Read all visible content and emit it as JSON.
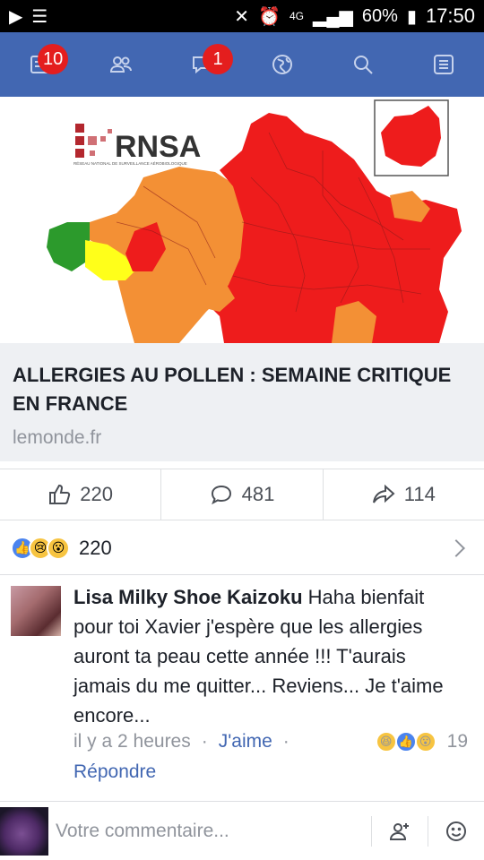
{
  "status_bar": {
    "battery": "60%",
    "time": "17:50",
    "network": "4G"
  },
  "nav": {
    "items": [
      {
        "icon": "news-feed-icon",
        "badge": "10"
      },
      {
        "icon": "friends-icon",
        "badge": ""
      },
      {
        "icon": "messages-icon",
        "badge": "1"
      },
      {
        "icon": "globe-icon",
        "badge": ""
      },
      {
        "icon": "search-icon",
        "badge": ""
      },
      {
        "icon": "menu-icon",
        "badge": ""
      }
    ]
  },
  "map": {
    "logo_text": "RNSA",
    "logo_subtext": "RÉSEAU NATIONAL DE SURVEILLANCE AÉROBIOLOGIQUE",
    "colors": {
      "red": "#ee1c1c",
      "orange": "#f39035",
      "yellow": "#ffff1a",
      "green": "#2c9a2c"
    }
  },
  "link": {
    "title": "ALLERGIES AU POLLEN : SEMAINE CRITIQUE EN FRANCE",
    "domain": "lemonde.fr"
  },
  "actions": {
    "like_count": "220",
    "comment_count": "481",
    "share_count": "114"
  },
  "reactions": {
    "count": "220",
    "types": [
      "like",
      "sad",
      "wow"
    ]
  },
  "comment": {
    "author": "Lisa Milky Shoe Kaizoku",
    "text": "Haha bienfait pour toi Xavier j'espère que les allergies auront ta peau cette année !!! T'aurais jamais du me quitter... Reviens... Je t'aime encore...",
    "time": "il y a 2 heures",
    "like_label": "J'aime",
    "reaction_count": "19",
    "reply_label": "Répondre"
  },
  "compose": {
    "placeholder": "Votre commentaire..."
  }
}
